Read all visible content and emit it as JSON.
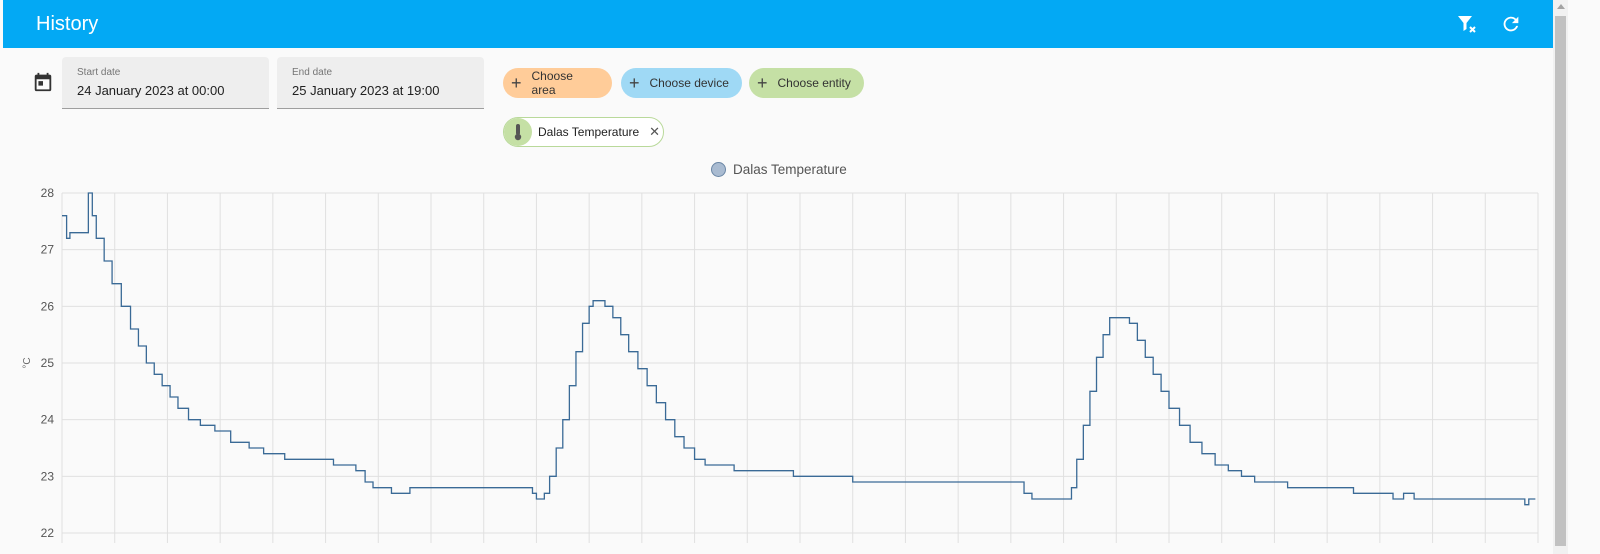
{
  "app": {
    "title": "History"
  },
  "topbar": {
    "icons": [
      "filter-remove-icon",
      "refresh-icon"
    ]
  },
  "date_range": {
    "start_label": "Start date",
    "start_value": "24 January 2023 at 00:00",
    "end_label": "End date",
    "end_value": "25 January 2023 at 19:00"
  },
  "target_chips": {
    "area": "Choose area",
    "device": "Choose device",
    "entity": "Choose entity"
  },
  "selected_entity": {
    "name": "Dalas Temperature",
    "icon": "thermometer-icon"
  },
  "colors": {
    "accent": "#03a9f4",
    "line": "#3a6a96"
  },
  "chart_data": {
    "type": "line",
    "step": true,
    "series": [
      {
        "name": "Dalas Temperature",
        "points": [
          [
            0,
            27.6
          ],
          [
            0.35,
            27.2
          ],
          [
            0.6,
            27.3
          ],
          [
            2,
            28.0
          ],
          [
            2.3,
            27.6
          ],
          [
            2.6,
            27.2
          ],
          [
            3.2,
            26.8
          ],
          [
            3.8,
            26.4
          ],
          [
            4.5,
            26.0
          ],
          [
            5.2,
            25.6
          ],
          [
            5.8,
            25.3
          ],
          [
            6.4,
            25.0
          ],
          [
            7.0,
            24.8
          ],
          [
            7.6,
            24.6
          ],
          [
            8.2,
            24.4
          ],
          [
            8.8,
            24.2
          ],
          [
            9.6,
            24.0
          ],
          [
            10.5,
            23.9
          ],
          [
            11.6,
            23.8
          ],
          [
            12.8,
            23.6
          ],
          [
            14.2,
            23.5
          ],
          [
            15.3,
            23.4
          ],
          [
            16.9,
            23.3
          ],
          [
            19.6,
            23.3
          ],
          [
            20.6,
            23.2
          ],
          [
            22.3,
            23.1
          ],
          [
            23.0,
            22.9
          ],
          [
            23.6,
            22.8
          ],
          [
            25.0,
            22.7
          ],
          [
            26.4,
            22.8
          ],
          [
            35.7,
            22.7
          ],
          [
            36.0,
            22.6
          ],
          [
            36.6,
            22.7
          ],
          [
            37.0,
            23.0
          ],
          [
            37.5,
            23.5
          ],
          [
            38.0,
            24.0
          ],
          [
            38.5,
            24.6
          ],
          [
            39.0,
            25.2
          ],
          [
            39.5,
            25.7
          ],
          [
            40.0,
            26.0
          ],
          [
            40.3,
            26.1
          ],
          [
            41.2,
            26.0
          ],
          [
            41.8,
            25.8
          ],
          [
            42.4,
            25.5
          ],
          [
            43.0,
            25.2
          ],
          [
            43.7,
            24.9
          ],
          [
            44.4,
            24.6
          ],
          [
            45.1,
            24.3
          ],
          [
            45.8,
            24.0
          ],
          [
            46.5,
            23.7
          ],
          [
            47.2,
            23.5
          ],
          [
            48.0,
            23.3
          ],
          [
            48.8,
            23.2
          ],
          [
            50.0,
            23.2
          ],
          [
            51.0,
            23.1
          ],
          [
            55.5,
            23.0
          ],
          [
            58.5,
            23.0
          ],
          [
            60.0,
            22.9
          ],
          [
            64.0,
            22.9
          ],
          [
            68.0,
            22.9
          ],
          [
            72.0,
            22.9
          ],
          [
            73.0,
            22.7
          ],
          [
            73.6,
            22.6
          ],
          [
            76.0,
            22.6
          ],
          [
            76.6,
            22.8
          ],
          [
            77.0,
            23.3
          ],
          [
            77.5,
            23.9
          ],
          [
            78.0,
            24.5
          ],
          [
            78.5,
            25.1
          ],
          [
            79.0,
            25.5
          ],
          [
            79.5,
            25.8
          ],
          [
            80.5,
            25.8
          ],
          [
            81.0,
            25.7
          ],
          [
            81.6,
            25.4
          ],
          [
            82.2,
            25.1
          ],
          [
            82.8,
            24.8
          ],
          [
            83.4,
            24.5
          ],
          [
            84.0,
            24.2
          ],
          [
            84.8,
            23.9
          ],
          [
            85.6,
            23.6
          ],
          [
            86.5,
            23.4
          ],
          [
            87.5,
            23.2
          ],
          [
            88.5,
            23.1
          ],
          [
            89.5,
            23.0
          ],
          [
            90.5,
            22.9
          ],
          [
            93.0,
            22.8
          ],
          [
            97.0,
            22.8
          ],
          [
            98.0,
            22.7
          ],
          [
            100.0,
            22.7
          ],
          [
            101.0,
            22.6
          ],
          [
            101.8,
            22.7
          ],
          [
            102.6,
            22.6
          ],
          [
            110.0,
            22.6
          ],
          [
            111.0,
            22.5
          ],
          [
            111.3,
            22.6
          ]
        ]
      }
    ],
    "xlim": [
      0,
      112
    ],
    "ylim": [
      22,
      28
    ],
    "y_ticks": [
      22,
      23,
      24,
      25,
      26,
      27,
      28
    ],
    "ylabel": "°C",
    "grid": true,
    "legend_position": "top-center"
  }
}
